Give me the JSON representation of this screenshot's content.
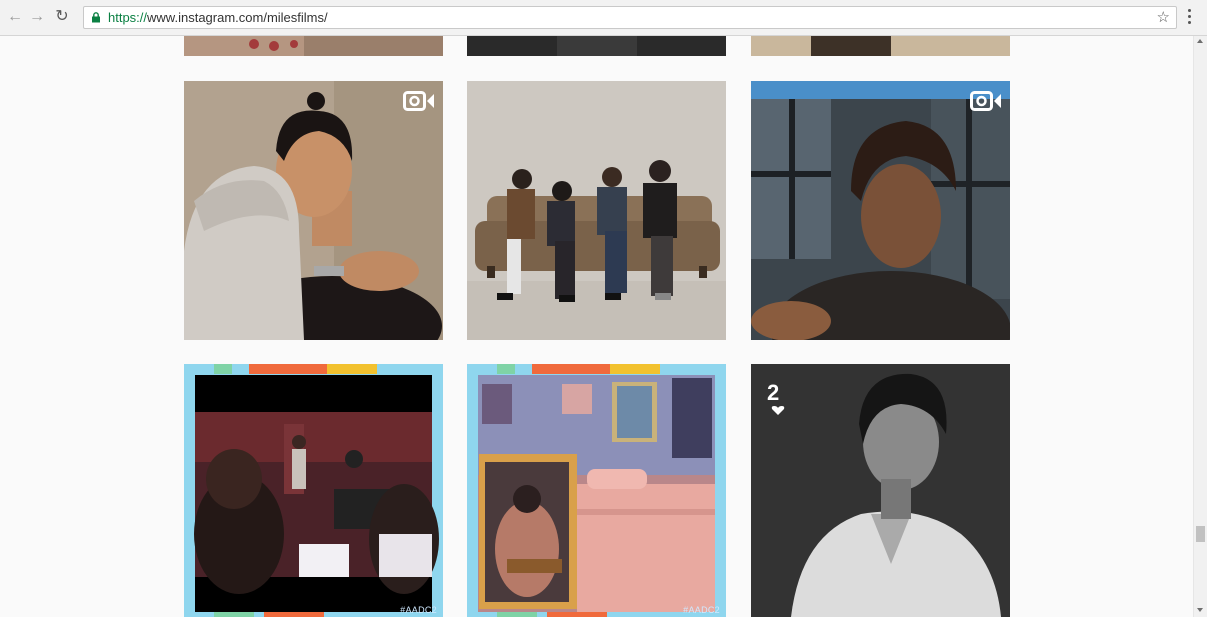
{
  "browser": {
    "url_scheme": "https://",
    "url_rest": "www.instagram.com/milesfilms/"
  },
  "posts": [
    {
      "row": 1,
      "col": 1,
      "has_video_icon": true
    },
    {
      "row": 1,
      "col": 2,
      "has_video_icon": false
    },
    {
      "row": 1,
      "col": 3,
      "has_video_icon": true
    },
    {
      "row": 2,
      "col": 1,
      "overlay_text": "#AADC2"
    },
    {
      "row": 2,
      "col": 2,
      "overlay_text": "#AADC2"
    },
    {
      "row": 2,
      "col": 3,
      "badge_text": "2"
    }
  ],
  "colors": {
    "page_bg": "#fafafa",
    "frame_blue": "#8fd6ee",
    "frame_stripe_green": "#7fd3a6",
    "frame_stripe_orange": "#f06a3c",
    "frame_stripe_yellow": "#f2c12e"
  }
}
